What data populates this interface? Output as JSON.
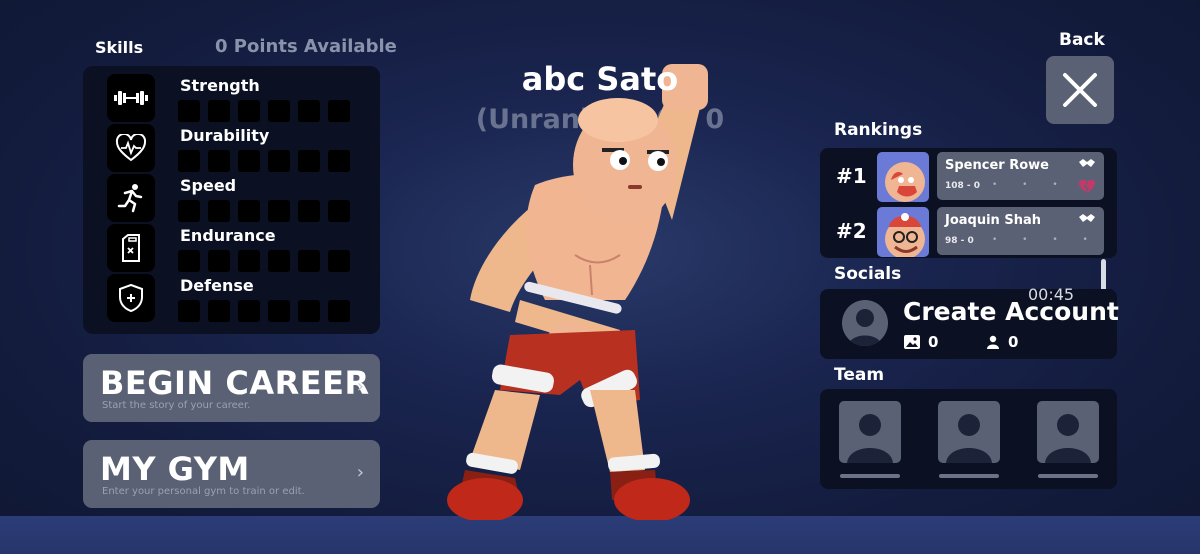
{
  "skills": {
    "header": "Skills",
    "points": "0 Points Available",
    "items": [
      {
        "label": "Strength",
        "icon": "dumbbell-icon",
        "filled": 0
      },
      {
        "label": "Durability",
        "icon": "heart-pulse-icon",
        "filled": 0
      },
      {
        "label": "Speed",
        "icon": "running-icon",
        "filled": 0
      },
      {
        "label": "Endurance",
        "icon": "fuel-can-icon",
        "filled": 0
      },
      {
        "label": "Defense",
        "icon": "shield-icon",
        "filled": 0
      }
    ]
  },
  "career_button": {
    "title": "BEGIN CAREER",
    "subtitle": "Start the story of your career."
  },
  "gym_button": {
    "title": "MY GYM",
    "subtitle": "Enter your personal gym to train or edit."
  },
  "character": {
    "name": "abc Sato",
    "rank": "(Unranked) 0 - 0"
  },
  "back": {
    "label": "Back"
  },
  "rankings": {
    "title": "Rankings",
    "entries": [
      {
        "rank": "#1",
        "name": "Spencer Rowe",
        "record": "108 - 0"
      },
      {
        "rank": "#2",
        "name": "Joaquin Shah",
        "record": "98 - 0"
      }
    ]
  },
  "socials": {
    "title": "Socials",
    "timer": "00:45",
    "create_account": "Create Account",
    "photos": "0",
    "followers": "0"
  },
  "team": {
    "title": "Team"
  },
  "colors": {
    "panel": "#0b1022",
    "button": "#5b6174",
    "background": "#1a2550"
  }
}
